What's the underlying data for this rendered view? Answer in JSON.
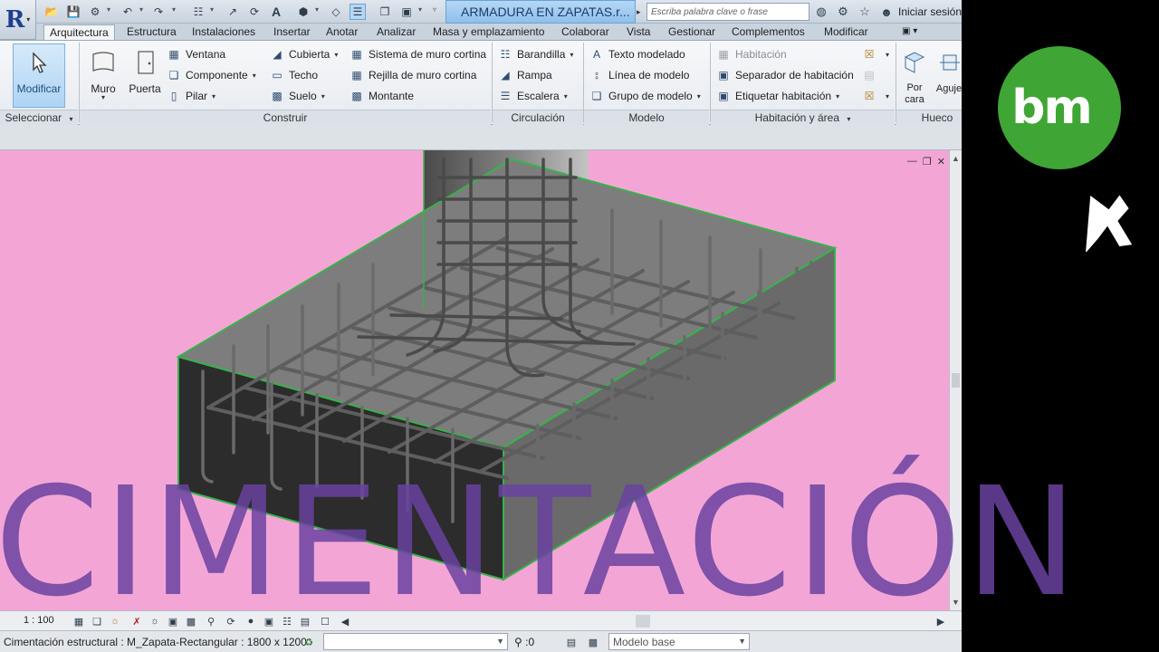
{
  "app": {
    "title": "ARMADURA EN ZAPATAS.r...",
    "search_placeholder": "Escriba palabra clave o frase",
    "signin": "Iniciar sesión"
  },
  "tabs": [
    "Arquitectura",
    "Estructura",
    "Instalaciones",
    "Insertar",
    "Anotar",
    "Analizar",
    "Masa y emplazamiento",
    "Colaborar",
    "Vista",
    "Gestionar",
    "Complementos",
    "Modificar"
  ],
  "ribbon": {
    "seleccionar": {
      "modify_label": "Modificar",
      "panel": "Seleccionar"
    },
    "construir": {
      "panel": "Construir",
      "muro": "Muro",
      "puerta": "Puerta",
      "ventana": "Ventana",
      "componente": "Componente",
      "pilar": "Pilar",
      "cubierta": "Cubierta",
      "techo": "Techo",
      "suelo": "Suelo",
      "sistema_muro_cortina": "Sistema de muro cortina",
      "rejilla_muro_cortina": "Rejilla de muro cortina",
      "montante": "Montante"
    },
    "circulacion": {
      "panel": "Circulación",
      "barandilla": "Barandilla",
      "rampa": "Rampa",
      "escalera": "Escalera"
    },
    "modelo": {
      "panel": "Modelo",
      "texto_modelado": "Texto modelado",
      "linea_modelo": "Línea de modelo",
      "grupo_modelo": "Grupo de modelo"
    },
    "habitacion": {
      "panel": "Habitación y área",
      "habitacion": "Habitación",
      "separador": "Separador de habitación",
      "etiquetar": "Etiquetar habitación"
    },
    "hueco": {
      "panel": "Hueco",
      "por_cara": "Por\ncara",
      "agujero": "Aguje"
    }
  },
  "viewbar": {
    "scale": "1 : 100"
  },
  "status": {
    "text": "Cimentación estructural : M_Zapata-Rectangular : 1800 x 1200",
    "zero": ":0",
    "model": "Modelo base"
  },
  "overlay": {
    "headline": "CIMENTACIÓN",
    "logo": "bm"
  },
  "colors": {
    "viewport": "#f3a6d6",
    "headline": "#6a42a0",
    "logo": "#3fa535",
    "title_highlight": "#8ec0ec"
  }
}
